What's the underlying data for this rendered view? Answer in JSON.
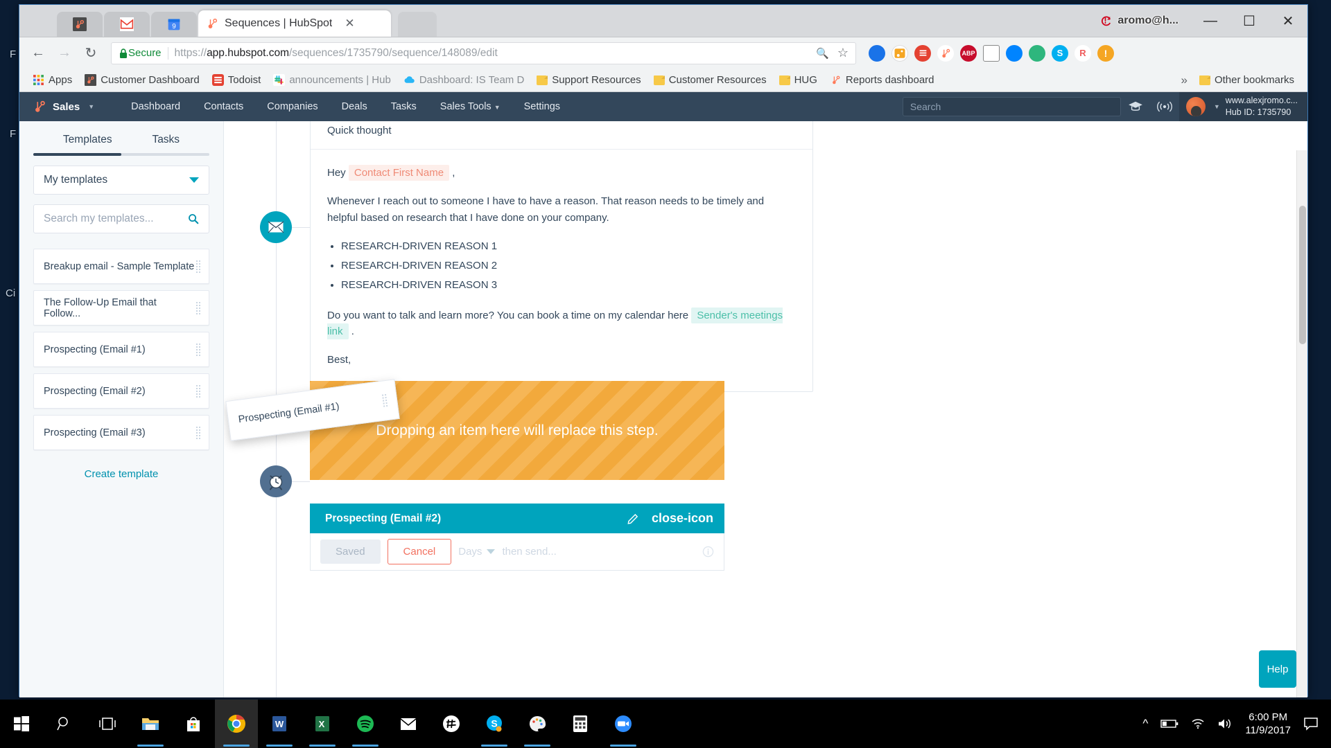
{
  "desktop": {
    "left_labels": [
      "F",
      "F",
      "Ci"
    ]
  },
  "window": {
    "account_label": "aromo@h...",
    "minimize": "—",
    "maximize": "☐",
    "close": "✕"
  },
  "browser": {
    "tabs": [
      {
        "title": "",
        "icon": "hubspot-icon",
        "active": false
      },
      {
        "title": "",
        "icon": "gmail-icon",
        "active": false
      },
      {
        "title": "",
        "icon": "google-calendar-icon",
        "badge": "9",
        "active": false
      },
      {
        "title": "Sequences | HubSpot",
        "icon": "hubspot-icon",
        "active": true,
        "close": "✕"
      }
    ],
    "back_icon": "←",
    "forward_icon": "→",
    "reload_icon": "↻",
    "secure_label": "Secure",
    "lock_icon": "🔒",
    "url_prefix": "https://",
    "url_bold": "app.hubspot.com",
    "url_rest": "/sequences/1735790/sequence/148089/edit",
    "search_icon": "🔍",
    "star_icon": "☆",
    "extensions": [
      {
        "name": "extension-blue-circle",
        "label": "",
        "color": "#1a73e8"
      },
      {
        "name": "extension-hubspot-sales",
        "label": "",
        "color": "#f5a623"
      },
      {
        "name": "extension-todoist",
        "label": "",
        "color": "#e44232"
      },
      {
        "name": "extension-hubspot",
        "label": "",
        "color": "#ff7a59"
      },
      {
        "name": "extension-adblock-plus",
        "label": "ABP",
        "color": "#c70d2c"
      },
      {
        "name": "extension-white-square",
        "label": "",
        "color": "#e8e8e8"
      },
      {
        "name": "extension-messenger",
        "label": "",
        "color": "#0084ff"
      },
      {
        "name": "extension-green-circle",
        "label": "",
        "color": "#2eb67d"
      },
      {
        "name": "extension-skype",
        "label": "S",
        "color": "#00aff0"
      },
      {
        "name": "extension-rapportive",
        "label": "R",
        "color": "#ef5b5b"
      },
      {
        "name": "extension-warning",
        "label": "!",
        "color": "#f5a623"
      }
    ],
    "bookmarks": [
      {
        "label": "Apps",
        "icon": "apps-grid-icon"
      },
      {
        "label": "Customer Dashboard",
        "icon": "hubspot-dark-icon"
      },
      {
        "label": "Todoist",
        "icon": "todoist-icon"
      },
      {
        "label": "announcements | Hub",
        "icon": "slack-icon"
      },
      {
        "label": "Dashboard: IS Team D",
        "icon": "cloud-icon"
      },
      {
        "label": "Support Resources",
        "icon": "folder-icon"
      },
      {
        "label": "Customer Resources",
        "icon": "folder-icon"
      },
      {
        "label": "HUG",
        "icon": "folder-icon"
      },
      {
        "label": "Reports dashboard",
        "icon": "hubspot-icon"
      }
    ],
    "overflow_label": "»",
    "other_bookmarks_label": "Other bookmarks",
    "other_bookmarks_icon": "folder-icon"
  },
  "hubspot_nav": {
    "product": "Sales",
    "links": [
      {
        "label": "Dashboard",
        "dropdown": false
      },
      {
        "label": "Contacts",
        "dropdown": false
      },
      {
        "label": "Companies",
        "dropdown": false
      },
      {
        "label": "Deals",
        "dropdown": false
      },
      {
        "label": "Tasks",
        "dropdown": false
      },
      {
        "label": "Sales Tools",
        "dropdown": true
      },
      {
        "label": "Settings",
        "dropdown": false
      }
    ],
    "search_placeholder": "Search",
    "academy_icon": "graduation-cap-icon",
    "notifications_icon": "broadcast-icon",
    "account_domain": "www.alexjromo.c...",
    "hub_id": "Hub ID: 1735790"
  },
  "left_panel": {
    "tabs": [
      {
        "label": "Templates",
        "active": true
      },
      {
        "label": "Tasks",
        "active": false
      }
    ],
    "folder_select_value": "My templates",
    "search_placeholder": "Search my templates...",
    "search_icon": "search-icon",
    "templates": [
      "Breakup email - Sample Template",
      "The Follow-Up Email that Follow...",
      "Prospecting (Email #1)",
      "Prospecting (Email #2)",
      "Prospecting (Email #3)"
    ],
    "create_template_label": "Create template"
  },
  "sequence": {
    "email_step": {
      "node_icon": "envelope-icon",
      "subject": "Quick thought",
      "greeting_prefix": "Hey",
      "greeting_token": "Contact First Name",
      "greeting_suffix": ",",
      "paragraph_1": "Whenever I reach out to someone I have to have a reason. That reason needs to be timely and helpful based on research that I have done on your company.",
      "bullets": [
        "RESEARCH-DRIVEN REASON 1",
        "RESEARCH-DRIVEN REASON 2",
        "RESEARCH-DRIVEN REASON 3"
      ],
      "cta_prefix": "Do you want to talk and learn more? You can book a time on my calendar here",
      "cta_token": "Sender's meetings link",
      "cta_suffix": ".",
      "signoff": "Best,"
    },
    "dropzone_message": "Dropping an item here will replace this step.",
    "drag_ghost_label": "Prospecting (Email #1)",
    "delay_node_icon": "alarm-clock-icon",
    "step_2": {
      "title": "Prospecting (Email #2)",
      "edit_icon": "pencil-icon",
      "close_icon": "close-icon",
      "saved_label": "Saved",
      "cancel_label": "Cancel",
      "delay_unit": "Days",
      "then_send_placeholder": "then send...",
      "info_icon": "info-icon"
    }
  },
  "help": {
    "label": "Help"
  },
  "taskbar": {
    "icons": [
      "windows-start-icon",
      "search-icon",
      "task-view-icon",
      "file-explorer-icon",
      "microsoft-store-icon",
      "chrome-icon",
      "word-icon",
      "excel-icon",
      "spotify-icon",
      "mail-icon",
      "slack-icon",
      "skype-icon",
      "edge-icon",
      "calculator-icon",
      "zoom-icon"
    ],
    "tray": {
      "chevron_icon": "chevron-up-icon",
      "battery_icon": "battery-icon",
      "wifi_icon": "wifi-icon",
      "volume_icon": "volume-icon",
      "time": "6:00 PM",
      "date": "11/9/2017",
      "action_center_icon": "notification-icon"
    }
  },
  "colors": {
    "hubspot_orange": "#ff7a59",
    "hubspot_navy": "#33475b",
    "hubspot_teal": "#00a4bd",
    "dropzone_orange": "#f2a93c",
    "token_red": "#ef8a76",
    "token_teal": "#4bbfa8"
  }
}
